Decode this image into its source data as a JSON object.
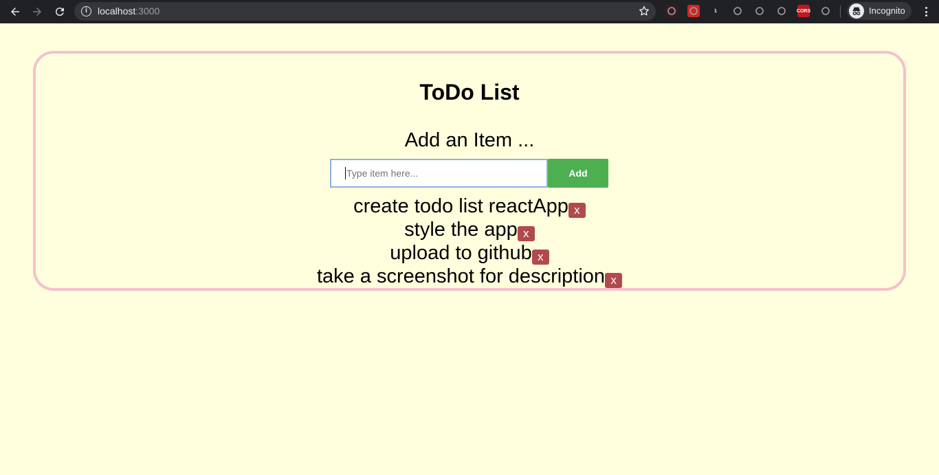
{
  "browser": {
    "url_host": "localhost",
    "url_port": ":3000",
    "profile_label": "Incognito",
    "extensions": [
      {
        "icon": "pdf-extension-icon",
        "label": "",
        "color": "#3a1c1c"
      },
      {
        "icon": "adblock-hand-icon",
        "label": "",
        "color": "#d42525"
      },
      {
        "icon": "password-manager-icon",
        "label": "1",
        "color": "#202124"
      },
      {
        "icon": "vue-devtools-icon",
        "label": "",
        "color": "#202124"
      },
      {
        "icon": "shield-extension-icon",
        "label": "",
        "color": "#202124"
      },
      {
        "icon": "react-devtools-icon",
        "label": "",
        "color": "#202124"
      },
      {
        "icon": "cors-extension-icon",
        "label": "CORS",
        "color": "#c4171c"
      },
      {
        "icon": "color-picker-extension-icon",
        "label": "",
        "color": "#202124"
      }
    ]
  },
  "app": {
    "title": "ToDo List",
    "add_heading": "Add an Item ...",
    "input_placeholder": "Type item here...",
    "input_value": "",
    "add_button_label": "Add",
    "delete_label": "x",
    "items": [
      "create todo list reactApp",
      "style the app",
      "upload to github",
      "take a screenshot for description"
    ]
  },
  "colors": {
    "page_background": "#ffffdd",
    "card_border": "#f5c0cb",
    "add_button": "#4caf50",
    "delete_button": "#b04a4d"
  }
}
